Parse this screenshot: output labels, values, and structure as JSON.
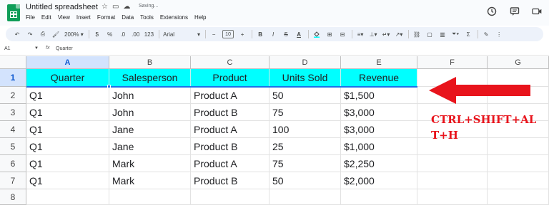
{
  "app": {
    "title": "Untitled spreadsheet",
    "status": "Saving...",
    "menu": [
      "File",
      "Edit",
      "View",
      "Insert",
      "Format",
      "Data",
      "Tools",
      "Extensions",
      "Help"
    ]
  },
  "toolbar": {
    "zoom": "200%",
    "currency": "$",
    "percent": "%",
    "decrease_decimal": ".0",
    "increase_decimal": ".00",
    "number_format": "123",
    "font": "Arial",
    "font_size": "10",
    "bold": "B",
    "italic": "I",
    "strikethrough": "S",
    "text_color": "A"
  },
  "formula_bar": {
    "cell_ref": "A1",
    "fx": "fx",
    "content": "Quarter"
  },
  "grid": {
    "columns": [
      "A",
      "B",
      "C",
      "D",
      "E",
      "F",
      "G"
    ],
    "rows": [
      "1",
      "2",
      "3",
      "4",
      "5",
      "6",
      "7",
      "8"
    ],
    "selected_column": "A",
    "selected_row": "1",
    "header_fill": "#00ffff",
    "headers": [
      "Quarter",
      "Salesperson",
      "Product",
      "Units Sold",
      "Revenue"
    ],
    "data": [
      [
        "Q1",
        "John",
        "Product A",
        "50",
        "$1,500"
      ],
      [
        "Q1",
        "John",
        "Product B",
        "75",
        "$3,000"
      ],
      [
        "Q1",
        "Jane",
        "Product A",
        "100",
        "$3,000"
      ],
      [
        "Q1",
        "Jane",
        "Product B",
        "25",
        "$1,000"
      ],
      [
        "Q1",
        "Mark",
        "Product A",
        "75",
        "$2,250"
      ],
      [
        "Q1",
        "Mark",
        "Product B",
        "50",
        "$2,000"
      ]
    ]
  },
  "annotation": {
    "shortcut_line1": "CTRL+SHIFT+AL",
    "shortcut_line2": "T+H",
    "color": "#e8141c"
  }
}
